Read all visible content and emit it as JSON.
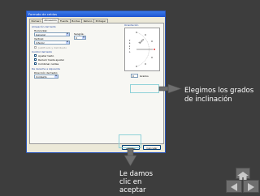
{
  "dialog": {
    "title": "Formato de celdas",
    "tabs": [
      "Número",
      "Alineación",
      "Fuente",
      "Bordes",
      "Relleno",
      "Proteger"
    ],
    "active_tab": "Alineación",
    "alignment_group": "Alineación del texto",
    "horizontal_label": "Horizontal:",
    "horizontal_value": "General",
    "vertical_label": "Vertical:",
    "vertical_value": "Inferior",
    "indent_label": "Sangría:",
    "indent_value": "0",
    "justify_distributed": "Justificado y distribuido",
    "text_control_group": "Control del texto",
    "wrap_text": "Ajustar texto",
    "shrink_to_fit": "Reducir hasta ajustar",
    "merge_cells": "Combinar celdas",
    "rtl_group": "De derecha a izquierda",
    "direction_label": "Dirección del texto:",
    "direction_value": "Contexto",
    "orientation_group": "Orientación",
    "vertical_text": [
      "T",
      "e",
      "x",
      "t",
      "o"
    ],
    "rotated_text": "Texto",
    "degrees_value": "0",
    "degrees_label": "Grados",
    "ok_button": "Aceptar",
    "cancel_button": "Cancelar"
  },
  "callouts": {
    "degrees_note": [
      "Elegimos los grados",
      "de inclinación"
    ],
    "ok_note": [
      "Le damos",
      "clic en",
      "aceptar"
    ]
  },
  "colors": {
    "background": "#3d3d3d",
    "highlight_border": "#8fd2d8",
    "arrow": "#6e6e6e"
  }
}
